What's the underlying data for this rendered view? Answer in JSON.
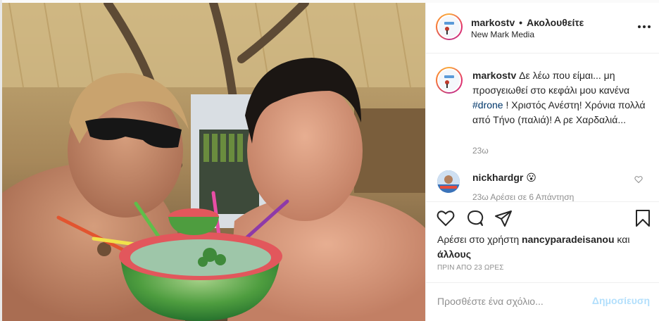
{
  "header": {
    "username": "markostv",
    "separator": "•",
    "follow_status": "Ακολουθείτε",
    "subtitle": "New Mark Media"
  },
  "caption": {
    "username": "markostv",
    "text_before_tag": "Δε λέω που είμαι... μη προσγειωθεί στο κεφάλι μου κανένα",
    "hashtag": "#drone",
    "text_after_tag": "! Χριστός Ανέστη! Χρόνια πολλά από Τήνο (παλιά)! Α ρε Χαρδαλιά...",
    "time": "23ω"
  },
  "comment": {
    "username": "nickhardgr",
    "emoji": "😮",
    "meta": "23ω    Αρέσει σε 6    Απάντηση"
  },
  "actions": {
    "like_icon": "heart-icon",
    "comment_icon": "comment-icon",
    "share_icon": "share-icon",
    "save_icon": "bookmark-icon"
  },
  "likes": {
    "prefix": "Αρέσει στο χρήστη",
    "user": "nancyparadeisanou",
    "connector": "και",
    "others": "άλλους"
  },
  "timestamp": "ΠΡΙΝ ΑΠΟ 23 ΩΡΕΣ",
  "composer": {
    "placeholder": "Προσθέστε ένα σχόλιο...",
    "post_label": "Δημοσίευση"
  },
  "colors": {
    "link": "#00376b",
    "muted": "#8e8e8e",
    "post_disabled": "#b2dffc"
  }
}
